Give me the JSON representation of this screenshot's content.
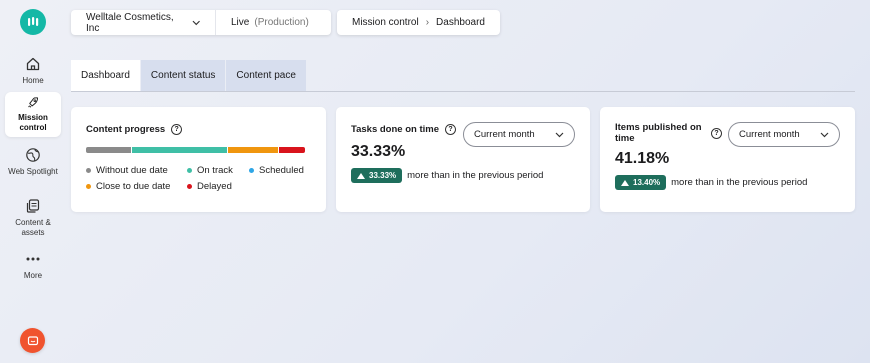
{
  "sidebar": {
    "items": [
      {
        "label": "Home",
        "icon": "home-icon"
      },
      {
        "label": "Mission control",
        "icon": "rocket-icon"
      },
      {
        "label": "Web Spotlight",
        "icon": "globe-icon"
      },
      {
        "label": "Content & assets",
        "icon": "files-icon"
      },
      {
        "label": "More",
        "icon": "dots-icon"
      }
    ]
  },
  "topbar": {
    "project": "Welltale Cosmetics, Inc",
    "environment": "Live",
    "environment_note": "(Production)",
    "breadcrumb_parent": "Mission control",
    "breadcrumb_current": "Dashboard"
  },
  "tabs": [
    "Dashboard",
    "Content status",
    "Content pace"
  ],
  "content_progress": {
    "title": "Content progress",
    "segments": [
      {
        "name": "Without due date",
        "color": "#8a8a8a",
        "fraction": 0.21
      },
      {
        "name": "On track",
        "color": "#3fbfa6",
        "fraction": 0.44
      },
      {
        "name": "Close to due date",
        "color": "#f0960f",
        "fraction": 0.23
      },
      {
        "name": "Delayed",
        "color": "#d9141c",
        "fraction": 0.12
      }
    ],
    "legend": [
      {
        "label": "Without due date",
        "color": "#8a8a8a"
      },
      {
        "label": "On track",
        "color": "#3fbfa6"
      },
      {
        "label": "Scheduled",
        "color": "#2ea6e6"
      },
      {
        "label": "Close to due date",
        "color": "#f0960f"
      },
      {
        "label": "Delayed",
        "color": "#d9141c"
      }
    ]
  },
  "tasks_done": {
    "title": "Tasks done on time",
    "period": "Current month",
    "value": "33.33%",
    "badge": "33.33%",
    "comparison": "more than in the previous period"
  },
  "items_published": {
    "title": "Items published on time",
    "period": "Current month",
    "value": "41.18%",
    "badge": "13.40%",
    "comparison": "more than in the previous period"
  },
  "colors": {
    "accent": "#14b8a6",
    "badge_bg": "#1e6e5c",
    "chat_button": "#f0532e"
  }
}
